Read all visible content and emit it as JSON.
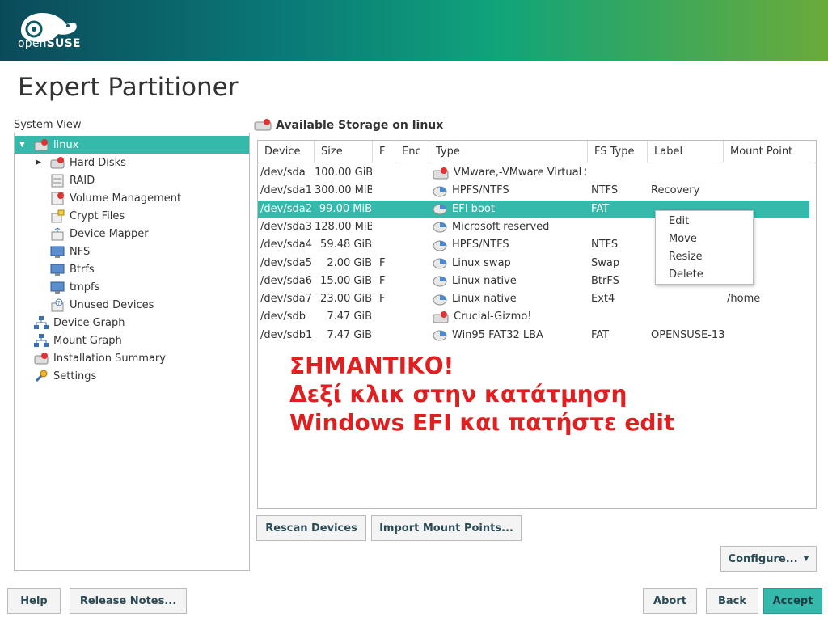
{
  "brand": {
    "logo_text_light": "open",
    "logo_text_bold": "SUSE"
  },
  "page_title": "Expert Partitioner",
  "system_view": {
    "label": "System View",
    "items": [
      {
        "label": "linux",
        "icon": "hard-disk-icon",
        "selected": true,
        "expander": "expanded"
      },
      {
        "label": "Hard Disks",
        "icon": "hard-disk-icon",
        "expander": "collapsed"
      },
      {
        "label": "RAID",
        "icon": "raid-icon"
      },
      {
        "label": "Volume Management",
        "icon": "volume-icon"
      },
      {
        "label": "Crypt Files",
        "icon": "crypt-icon"
      },
      {
        "label": "Device Mapper",
        "icon": "device-mapper-icon"
      },
      {
        "label": "NFS",
        "icon": "nfs-icon"
      },
      {
        "label": "Btrfs",
        "icon": "btrfs-icon"
      },
      {
        "label": "tmpfs",
        "icon": "tmpfs-icon"
      },
      {
        "label": "Unused Devices",
        "icon": "unused-devices-icon"
      },
      {
        "label": "Device Graph",
        "icon": "graph-icon"
      },
      {
        "label": "Mount Graph",
        "icon": "graph-icon"
      },
      {
        "label": "Installation Summary",
        "icon": "summary-icon"
      },
      {
        "label": "Settings",
        "icon": "settings-icon"
      }
    ]
  },
  "storage": {
    "title": "Available Storage on linux",
    "columns": [
      "Device",
      "Size",
      "F",
      "Enc",
      "Type",
      "FS Type",
      "Label",
      "Mount Point"
    ],
    "rows": [
      {
        "device": "/dev/sda",
        "size": "100.00 GiB",
        "f": "",
        "enc": "",
        "type": "VMware,-VMware Virtual S",
        "fs_type": "",
        "label": "",
        "mount": "",
        "icon": "disk"
      },
      {
        "device": "/dev/sda1",
        "size": "300.00 MiB",
        "f": "",
        "enc": "",
        "type": "HPFS/NTFS",
        "fs_type": "NTFS",
        "label": "Recovery",
        "mount": "",
        "icon": "partition"
      },
      {
        "device": "/dev/sda2",
        "size": "99.00 MiB",
        "f": "",
        "enc": "",
        "type": "EFI boot",
        "fs_type": "FAT",
        "label": "",
        "mount": "",
        "icon": "partition",
        "selected": true
      },
      {
        "device": "/dev/sda3",
        "size": "128.00 MiB",
        "f": "",
        "enc": "",
        "type": "Microsoft reserved",
        "fs_type": "",
        "label": "",
        "mount": "",
        "icon": "partition"
      },
      {
        "device": "/dev/sda4",
        "size": "59.48 GiB",
        "f": "",
        "enc": "",
        "type": "HPFS/NTFS",
        "fs_type": "NTFS",
        "label": "",
        "mount": "",
        "icon": "partition"
      },
      {
        "device": "/dev/sda5",
        "size": "2.00 GiB",
        "f": "F",
        "enc": "",
        "type": "Linux swap",
        "fs_type": "Swap",
        "label": "",
        "mount": "",
        "icon": "partition"
      },
      {
        "device": "/dev/sda6",
        "size": "15.00 GiB",
        "f": "F",
        "enc": "",
        "type": "Linux native",
        "fs_type": "BtrFS",
        "label": "",
        "mount": "",
        "icon": "partition"
      },
      {
        "device": "/dev/sda7",
        "size": "23.00 GiB",
        "f": "F",
        "enc": "",
        "type": "Linux native",
        "fs_type": "Ext4",
        "label": "",
        "mount": "/home",
        "icon": "partition"
      },
      {
        "device": "/dev/sdb",
        "size": "7.47 GiB",
        "f": "",
        "enc": "",
        "type": "Crucial-Gizmo!",
        "fs_type": "",
        "label": "",
        "mount": "",
        "icon": "disk"
      },
      {
        "device": "/dev/sdb1",
        "size": "7.47 GiB",
        "f": "",
        "enc": "",
        "type": "Win95 FAT32 LBA",
        "fs_type": "FAT",
        "label": "OPENSUSE-13",
        "mount": "",
        "icon": "partition"
      }
    ]
  },
  "context_menu": {
    "items": [
      "Edit",
      "Move",
      "Resize",
      "Delete"
    ]
  },
  "overlay_note": {
    "line1": "ΣΗΜΑΝΤΙΚΟ!",
    "line2": "Δεξί κλικ στην κατάτμηση",
    "line3": "Windows EFI και πατήστε edit",
    "color": "#e02020"
  },
  "buttons": {
    "rescan": "Rescan Devices",
    "import_mount": "Import Mount Points...",
    "configure": "Configure...",
    "help": "Help",
    "release_notes": "Release Notes...",
    "abort": "Abort",
    "back": "Back",
    "accept": "Accept"
  },
  "colors": {
    "accent": "#35b9ab",
    "selection_text": "#ffffff"
  }
}
